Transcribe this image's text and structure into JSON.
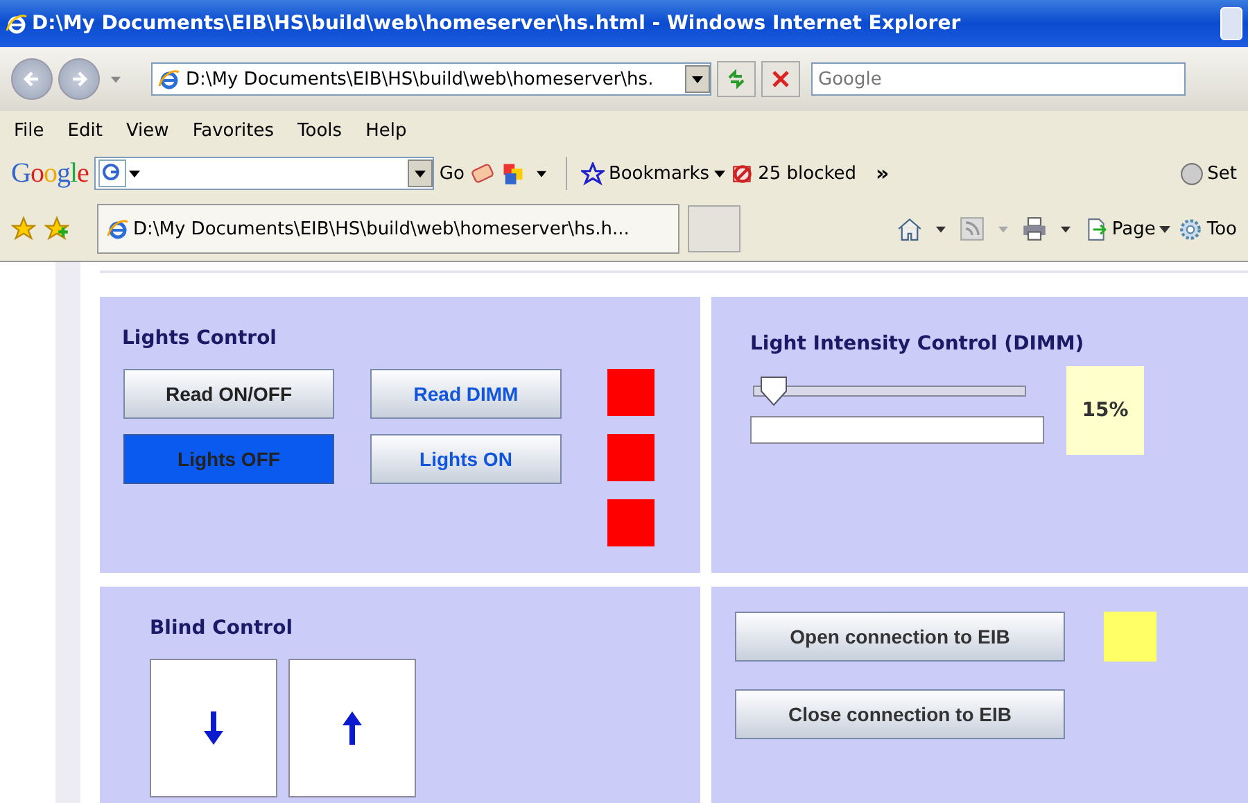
{
  "window": {
    "title": "D:\\My Documents\\EIB\\HS\\build\\web\\homeserver\\hs.html - Windows Internet Explorer"
  },
  "nav": {
    "address": "D:\\My Documents\\EIB\\HS\\build\\web\\homeserver\\hs.",
    "search": {
      "placeholder": "Google"
    }
  },
  "menu": [
    "File",
    "Edit",
    "View",
    "Favorites",
    "Tools",
    "Help"
  ],
  "google_toolbar": {
    "logo": "Google",
    "go": "Go",
    "bookmarks": "Bookmarks",
    "blocked": "25 blocked",
    "more": "»",
    "settings": "Set"
  },
  "tab": {
    "title": "D:\\My Documents\\EIB\\HS\\build\\web\\homeserver\\hs.h..."
  },
  "command_bar": {
    "page": "Page",
    "tools": "Too"
  },
  "lights": {
    "title": "Lights Control",
    "buttons": [
      {
        "label": "Read ON/OFF",
        "selected": false,
        "kind": "switch"
      },
      {
        "label": "Read DIMM",
        "selected": false,
        "kind": "dimm"
      },
      {
        "label": "Lights OFF",
        "selected": true,
        "kind": "switch"
      },
      {
        "label": "Lights ON",
        "selected": false,
        "kind": "dimm"
      }
    ],
    "indicators": [
      {
        "color": "#ff0000"
      },
      {
        "color": "#ff0000"
      },
      {
        "color": "#ff0000"
      }
    ]
  },
  "dimm": {
    "title": "Light Intensity Control (DIMM)",
    "level": 0.03,
    "value": "15%"
  },
  "blind": {
    "title": "Blind Control",
    "buttons": [
      {
        "kind": "down"
      },
      {
        "kind": "up"
      }
    ]
  },
  "connection": {
    "buttons": [
      "Open connection to EIB",
      "Close connection to EIB"
    ],
    "indicator": {
      "color": "#ffff66"
    }
  }
}
